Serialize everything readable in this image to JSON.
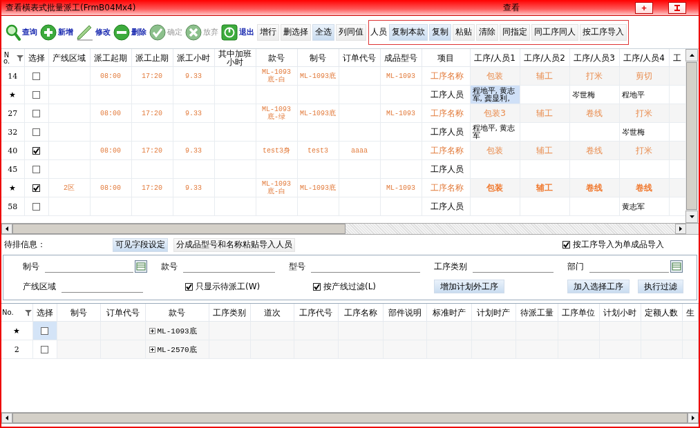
{
  "window": {
    "title": "查看橫表式批量派工(FrmB04Mx4)",
    "caption": "查看",
    "plus_button": "+"
  },
  "toolbar": {
    "tools": [
      {
        "label": "查询",
        "disabled": false
      },
      {
        "label": "新增",
        "disabled": false
      },
      {
        "label": "修改",
        "disabled": false
      },
      {
        "label": "删除",
        "disabled": false
      },
      {
        "label": "确定",
        "disabled": true
      },
      {
        "label": "放弃",
        "disabled": true
      },
      {
        "label": "退出",
        "disabled": false
      }
    ],
    "buttons": [
      {
        "label": "增行",
        "highlighted": false
      },
      {
        "label": "删选择",
        "highlighted": false
      },
      {
        "label": "全选",
        "highlighted": true
      },
      {
        "label": "列同值",
        "highlighted": false
      }
    ],
    "staff_label": "人员",
    "staff_buttons": [
      {
        "label": "复制本款",
        "highlighted": true
      },
      {
        "label": "复制",
        "highlighted": true
      },
      {
        "label": "粘贴",
        "highlighted": false
      },
      {
        "label": "清除",
        "highlighted": false
      },
      {
        "label": "同指定",
        "highlighted": false
      },
      {
        "label": "同工序同人",
        "highlighted": false
      },
      {
        "label": "按工序导入",
        "highlighted": false
      }
    ]
  },
  "grid": {
    "columns": [
      "No.",
      "选择",
      "产线区域",
      "派工起期",
      "派工止期",
      "派工小时",
      "其中加班小时",
      "款号",
      "制号",
      "订单代号",
      "成品型号",
      "项目",
      "工序/人员1",
      "工序/人员2",
      "工序/人员3",
      "工序/人员4",
      "工"
    ],
    "rows": [
      {
        "marker": "14",
        "checked": false,
        "kind": "process",
        "current": false,
        "start": "08:00",
        "end": "17:20",
        "hours": "9.33",
        "style": "ML-1093底-白",
        "lot": "ML-1093底",
        "model": "ML-1093",
        "item": "工序名称",
        "steps": [
          {
            "text": "包装",
            "selected": false
          },
          {
            "text": "辅工",
            "selected": false
          },
          {
            "text": "打米",
            "selected": false
          },
          {
            "text": "剪切",
            "selected": false
          }
        ]
      },
      {
        "marker": "★",
        "checked": false,
        "kind": "staff",
        "item": "工序人员",
        "steps": [
          {
            "text": "程地平, 黄志军, 龚显利,",
            "selected": true
          },
          {
            "selected": false
          },
          {
            "text": "岑世梅",
            "selected": false
          },
          {
            "text": "程地平",
            "selected": false
          }
        ]
      },
      {
        "marker": "27",
        "checked": false,
        "kind": "process",
        "current": false,
        "start": "08:00",
        "end": "17:20",
        "hours": "9.33",
        "style": "ML-1093底-绿",
        "lot": "ML-1093底",
        "model": "ML-1093",
        "item": "工序名称",
        "steps": [
          {
            "text": "包装3",
            "selected": false
          },
          {
            "text": "辅工",
            "selected": false
          },
          {
            "text": "卷线",
            "selected": false
          },
          {
            "text": "打米",
            "selected": false
          }
        ]
      },
      {
        "marker": "32",
        "checked": false,
        "kind": "staff",
        "item": "工序人员",
        "steps": [
          {
            "text": "程地平, 黄志军",
            "selected": false
          },
          {
            "selected": false
          },
          {
            "selected": false
          },
          {
            "text": "岑世梅",
            "selected": false
          }
        ]
      },
      {
        "marker": "40",
        "checked": true,
        "kind": "process",
        "current": false,
        "start": "08:00",
        "end": "17:20",
        "hours": "9.33",
        "style": "test3身",
        "lot": "test3",
        "order": "aaaa",
        "item": "工序名称",
        "steps": [
          {
            "text": "包装",
            "selected": false
          },
          {
            "text": "辅工",
            "selected": false
          },
          {
            "text": "卷线",
            "selected": false
          },
          {
            "text": "打米",
            "selected": false
          }
        ]
      },
      {
        "marker": "45",
        "checked": false,
        "kind": "staff",
        "item": "工序人员",
        "steps": [
          {
            "selected": false
          },
          {
            "selected": false
          },
          {
            "selected": false
          },
          {
            "selected": false
          }
        ]
      },
      {
        "marker": "★",
        "checked": true,
        "kind": "process",
        "current": true,
        "area": "2区",
        "start": "08:00",
        "end": "17:20",
        "hours": "9.33",
        "style": "ML-1093底-白",
        "lot": "ML-1093底",
        "model": "ML-1093",
        "item": "工序名称",
        "steps": [
          {
            "text": "包装",
            "selected": false
          },
          {
            "text": "辅工",
            "selected": false
          },
          {
            "text": "卷线",
            "selected": false
          },
          {
            "text": "卷线",
            "selected": false
          }
        ]
      },
      {
        "marker": "58",
        "checked": false,
        "kind": "staff",
        "item": "工序人员",
        "steps": [
          {
            "selected": false
          },
          {
            "selected": false
          },
          {
            "selected": false
          },
          {
            "text": "黄志军",
            "selected": false
          }
        ]
      }
    ]
  },
  "pending": {
    "label": "待排信息：",
    "buttons": [
      {
        "label": "可见字段设定",
        "highlighted": true
      },
      {
        "label": "分成品型号和名称粘贴导入人员",
        "highlighted": false
      }
    ],
    "import_option": {
      "label": "按工序导入为单成品导入",
      "checked": true
    }
  },
  "filters": {
    "fields": [
      {
        "label": "制号",
        "picker": true
      },
      {
        "label": "款号",
        "picker": false
      },
      {
        "label": "型号",
        "picker": false
      },
      {
        "label": "工序类别",
        "picker": false
      },
      {
        "label": "部门",
        "picker": true
      }
    ],
    "area_field": {
      "label": "产线区域"
    },
    "options": [
      {
        "label": "只显示待派工(W)",
        "checked": true
      },
      {
        "label": "按产线过滤(L)",
        "checked": true
      }
    ],
    "buttons": [
      "增加计划外工序",
      "加入选择工序",
      "执行过滤"
    ]
  },
  "pending_grid": {
    "columns": [
      "No.",
      "选择",
      "制号",
      "订单代号",
      "款号",
      "工序类别",
      "道次",
      "工序代号",
      "工序名称",
      "部件说明",
      "标准时产",
      "计划时产",
      "待派工量",
      "工序单位",
      "计划小时",
      "定额人数",
      "生"
    ],
    "rows": [
      {
        "marker": "★",
        "checked": false,
        "selected": true,
        "style": "ML-1093底"
      },
      {
        "marker": "2",
        "checked": false,
        "selected": false,
        "style": "ML-2570底"
      }
    ]
  }
}
